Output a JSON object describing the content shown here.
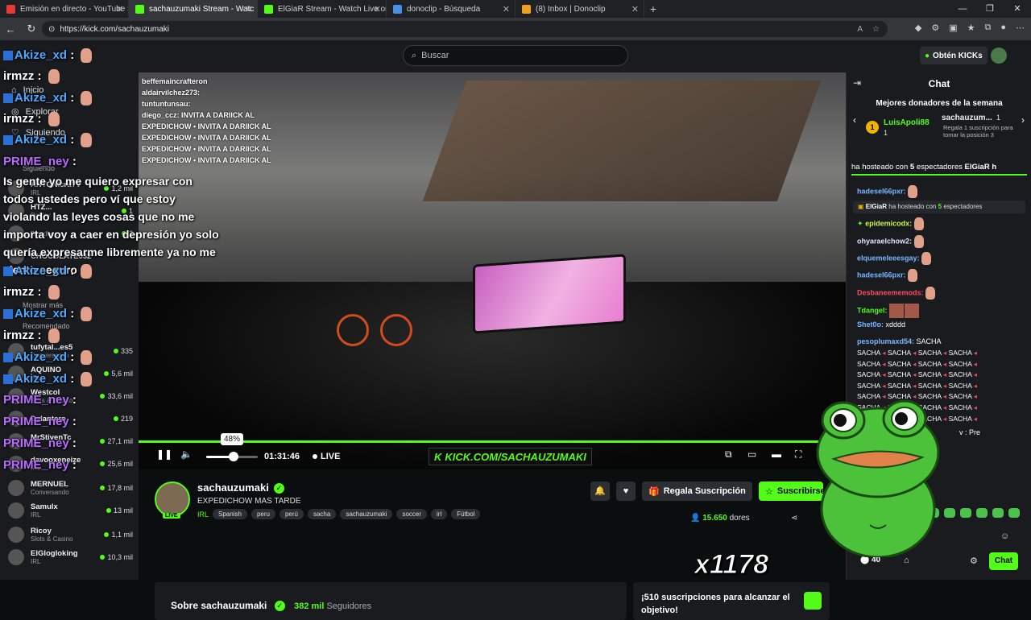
{
  "browser": {
    "tabs": [
      {
        "label": "Emisión en directo - YouTube Stu",
        "color": "#e53935",
        "active": false
      },
      {
        "label": "sachauzumaki Stream - Watc",
        "color": "#53fc18",
        "active": true
      },
      {
        "label": "ElGiaR Stream - Watch Live on Ki",
        "color": "#53fc18",
        "active": false
      },
      {
        "label": "donoclip - Búsqueda",
        "color": "#4a90e2",
        "active": false
      },
      {
        "label": "(8) Inbox | Donoclip",
        "color": "#f0a020",
        "active": false
      }
    ],
    "url": "https://kick.com/sachauzumaki"
  },
  "topnav": {
    "search_placeholder": "Buscar",
    "get_kicks": "Obtén KICKs"
  },
  "sidebar": {
    "nav": [
      "Inicio",
      "Explorar",
      "Siguiendo"
    ],
    "following_label": "Siguiendo",
    "show_more": "Mostrar más",
    "recommended_label": "Recomendado",
    "channels": [
      {
        "name": "ANTONIcraTV",
        "cat": "IRL",
        "viewers": "1,2 mil"
      },
      {
        "name": "HTZ...",
        "cat": "Roblox",
        "viewers": "1"
      },
      {
        "name": "",
        "cat": "Bloodborne",
        "viewers": "2"
      },
      {
        "name": "CHOCOLATE032",
        "cat": "",
        "viewers": ""
      },
      {
        "name": "tufytal...es5",
        "cat": "Conversando",
        "viewers": "335"
      },
      {
        "name": "AQUINO",
        "cat": "IRL",
        "viewers": "5,6 mil"
      },
      {
        "name": "Westcol",
        "cat": "Slots & Casino",
        "viewers": "33,6 mil"
      },
      {
        "name": "Dylantero",
        "cat": "",
        "viewers": "219"
      },
      {
        "name": "MrStivenTc",
        "cat": "IRL",
        "viewers": "27,1 mil"
      },
      {
        "name": "davooxeneize",
        "cat": "IRL",
        "viewers": "25,6 mil"
      },
      {
        "name": "MERNUEL",
        "cat": "Conversando",
        "viewers": "17,8 mil"
      },
      {
        "name": "Samulx",
        "cat": "IRL",
        "viewers": "13 mil"
      },
      {
        "name": "Ricoy",
        "cat": "Slots & Casino",
        "viewers": "1,1 mil"
      },
      {
        "name": "ElGlogloking",
        "cat": "IRL",
        "viewers": "10,3 mil"
      }
    ]
  },
  "overlay": {
    "lines": [
      {
        "user": "Akize_xd",
        "style": "b"
      },
      {
        "user": "irmzz",
        "style": "w"
      },
      {
        "user": "Akize_xd",
        "style": "b"
      },
      {
        "user": "irmzz",
        "style": "w"
      },
      {
        "user": "Akize_xd",
        "style": "b"
      },
      {
        "user": "PRIME_ney",
        "style": "p"
      }
    ],
    "long_msg": "Is gente yo me quiero expresar con todos ustedes pero ví que estoy violando las leyes cosas que no me importa voy a caer en depresión yo solo quería expresarme libremente ya no me siento seguro :(",
    "lines2": [
      {
        "user": "Akize_xd",
        "style": "b"
      },
      {
        "user": "irmzz",
        "style": "w"
      },
      {
        "user": "Akize_xd",
        "style": "b"
      },
      {
        "user": "irmzz",
        "style": "w"
      },
      {
        "user": "Akize_xd",
        "style": "b"
      },
      {
        "user": "Akize_xd",
        "style": "b"
      },
      {
        "user": "PRIME_ney",
        "style": "p"
      },
      {
        "user": "PRIME_ney",
        "style": "p"
      },
      {
        "user": "PRIME_ney",
        "style": "p"
      },
      {
        "user": "PRIME_ney",
        "style": "p"
      }
    ]
  },
  "stream_chat": [
    "beffemaincrafteron",
    "aldairvilchez273:",
    "tuntuntunsau:",
    "diego_ccz: INVITA A DARIICK AL",
    "EXPEDICHOW • INVITA A DARIICK AL",
    "EXPEDICHOW • INVITA A DARIICK AL",
    "EXPEDICHOW • INVITA A DARIICK AL",
    "EXPEDICHOW • INVITA A DARIICK AL"
  ],
  "player": {
    "volume_label": "48%",
    "volume": 0.48,
    "time": "01:31:46",
    "live": "LIVE",
    "watermark": "KICK.COM/SACHAUZUMAKI"
  },
  "channel": {
    "name": "sachauzumaki",
    "title": "EXPEDICHOW MAS TARDE",
    "category": "IRL",
    "tags": [
      "Spanish",
      "peru",
      "perú",
      "sacha",
      "sachauzumaki",
      "soccer",
      "irl",
      "Fútbol"
    ],
    "live_badge": "LIVE",
    "gift_label": "Regala Suscripción",
    "sub_label": "Suscribirse",
    "viewers": "15.650",
    "viewers_suffix": "dores",
    "overlay_count": "x1178"
  },
  "about": {
    "title": "Sobre sachauzumaki",
    "followers": "382 mil",
    "followers_label": "Seguidores"
  },
  "goal": {
    "text": "¡510 suscripciones para alcanzar el objetivo!"
  },
  "chat": {
    "title": "Chat",
    "top_donors": "Mejores donadores de la semana",
    "donor1_name": "LuisApoli88",
    "donor1_count": "1",
    "donor1_rank": "1",
    "donor2_name": "sachauzum...",
    "donor2_count": "1",
    "donor2_hint": "Regala 1 suscripción para tomar la posición 3",
    "host_banner_pre": "ha hosteado con",
    "host_banner_count": "5",
    "host_banner_post": "espectadores",
    "host_banner_user": "ElGiaR h",
    "messages": [
      {
        "user": "hadesel66pxr:",
        "style": "blue",
        "text": ""
      },
      {
        "user": "epidemicodx:",
        "style": "yellow",
        "text": ""
      },
      {
        "user": "ohyaraelchow2:",
        "style": "white",
        "text": ""
      },
      {
        "user": "elquemeleeesgay:",
        "style": "blue",
        "text": ""
      },
      {
        "user": "hadesel66pxr:",
        "style": "blue",
        "text": ""
      },
      {
        "user": "Desbaneememods:",
        "style": "red",
        "text": ""
      },
      {
        "user": "Tdangel:",
        "style": "green",
        "text": ""
      },
      {
        "user": "Shet0o:",
        "style": "blue",
        "text": "xdddd"
      },
      {
        "user": "pesoplumaxd54:",
        "style": "blue",
        "text": "SACHA"
      }
    ],
    "sys_host": {
      "user": "ElGiaR",
      "pre": "ha hosteado con",
      "count": "5",
      "post": "espectadores"
    },
    "sacha_line": "SACHA",
    "tail_msg": "v : Pre",
    "points": "40",
    "send": "Chat"
  }
}
